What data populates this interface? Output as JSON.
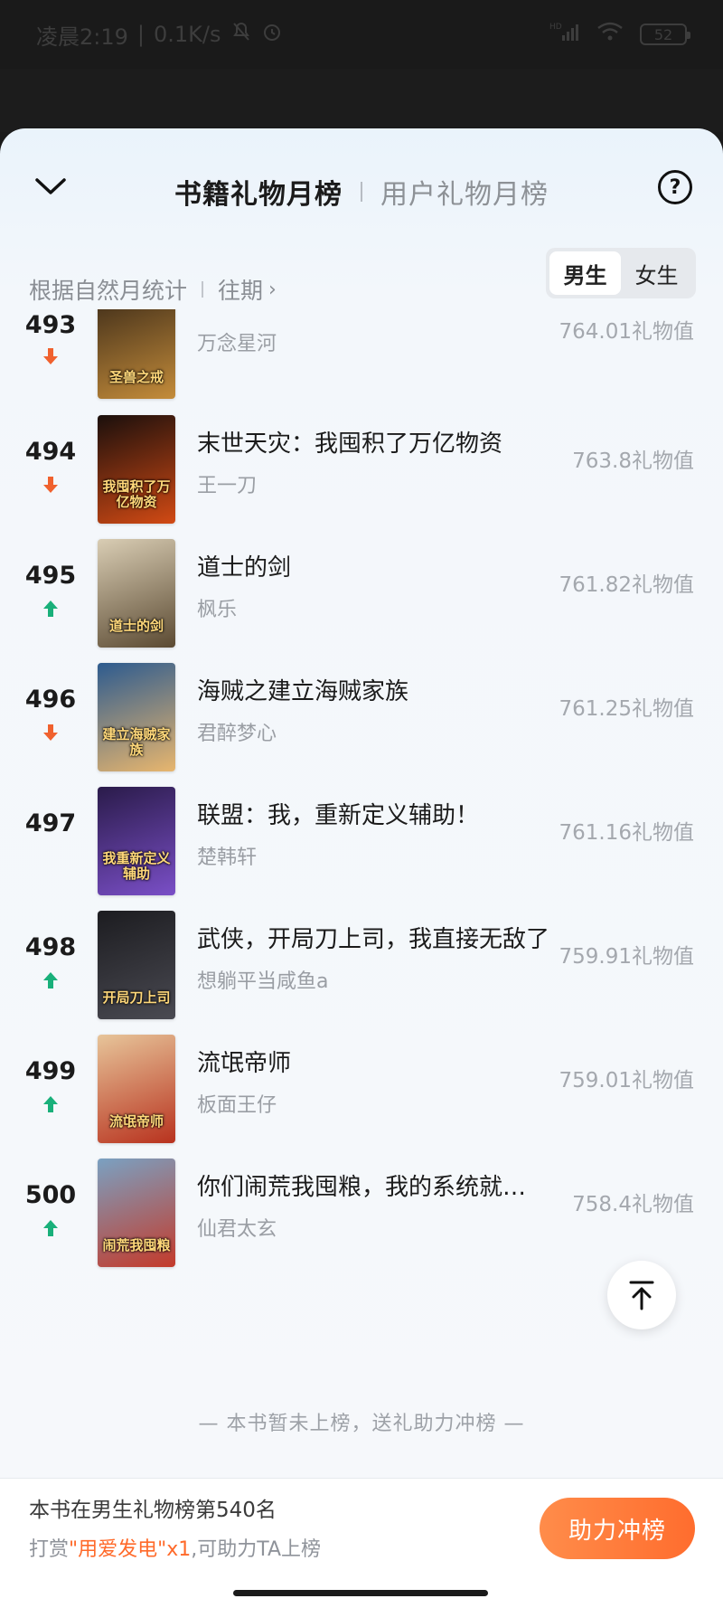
{
  "status_bar": {
    "time": "凌晨2:19",
    "net_speed": "0.1K/s",
    "signal": "HD",
    "battery": "52"
  },
  "header": {
    "tab_active": "书籍礼物月榜",
    "tab_inactive": "用户礼物月榜"
  },
  "filter": {
    "stat_text": "根据自然月统计",
    "period_label": "往期",
    "gender_male": "男生",
    "gender_female": "女生",
    "gender_selected": "男生"
  },
  "books": [
    {
      "rank": "493",
      "trend": "down",
      "title": "",
      "author": "万念星河",
      "value": "764.01礼物值",
      "cover_text": "圣兽之戒",
      "cover_colors": [
        "#3b2a18",
        "#c48c3a"
      ]
    },
    {
      "rank": "494",
      "trend": "down",
      "title": "末世天灾：我囤积了万亿物资",
      "author": "王一刀",
      "value": "763.8礼物值",
      "cover_text": "我囤积了万亿物资",
      "cover_colors": [
        "#1a0f0c",
        "#d24a14"
      ]
    },
    {
      "rank": "495",
      "trend": "up",
      "title": "道士的剑",
      "author": "枫乐",
      "value": "761.82礼物值",
      "cover_text": "道士的剑",
      "cover_colors": [
        "#d9cdb4",
        "#5b4a32"
      ]
    },
    {
      "rank": "496",
      "trend": "down",
      "title": "海贼之建立海贼家族",
      "author": "君醉梦心",
      "value": "761.25礼物值",
      "cover_text": "建立海贼家族",
      "cover_colors": [
        "#2d5b8f",
        "#e8b66e"
      ]
    },
    {
      "rank": "497",
      "trend": "none",
      "title": "联盟：我，重新定义辅助！",
      "author": "楚韩轩",
      "value": "761.16礼物值",
      "cover_text": "我重新定义辅助",
      "cover_colors": [
        "#2a1b4a",
        "#7a4fc7"
      ]
    },
    {
      "rank": "498",
      "trend": "up",
      "title": "武侠，开局刀上司，我直接无敌了",
      "author": "想躺平当咸鱼a",
      "value": "759.91礼物值",
      "cover_text": "开局刀上司",
      "cover_colors": [
        "#1c1c20",
        "#4a4a52"
      ]
    },
    {
      "rank": "499",
      "trend": "up",
      "title": "流氓帝师",
      "author": "板面王仔",
      "value": "759.01礼物值",
      "cover_text": "流氓帝师",
      "cover_colors": [
        "#e7c59a",
        "#b8321e"
      ]
    },
    {
      "rank": "500",
      "trend": "up",
      "title": "你们闹荒我囤粮，我的系统就要无敌了",
      "author": "仙君太玄",
      "value": "758.4礼物值",
      "cover_text": "闹荒我囤粮",
      "cover_colors": [
        "#7aa1c2",
        "#c43a2a"
      ]
    }
  ],
  "list_footer": "—   本书暂未上榜，送礼助力冲榜   —",
  "bottom": {
    "line1": "本书在男生礼物榜第540名",
    "line2_prefix": "打赏",
    "line2_highlight": "\"用爱发电\"x1",
    "line2_suffix": ",可助力TA上榜",
    "button": "助力冲榜"
  },
  "colors": {
    "trend_up": "#19b07a",
    "trend_down": "#f0612e",
    "accent": "#ff6d2e"
  }
}
